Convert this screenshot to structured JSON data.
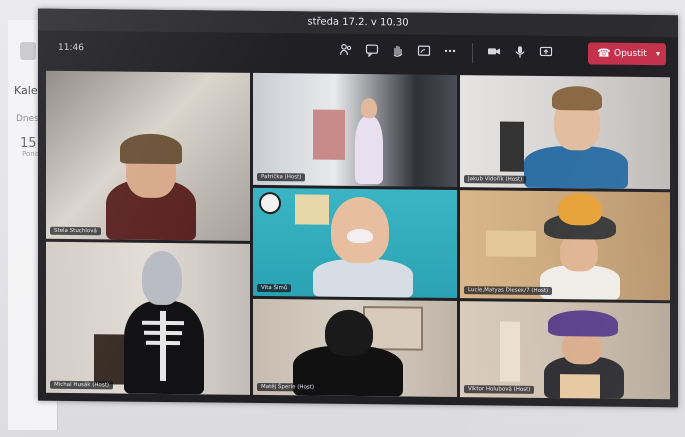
{
  "background_app": {
    "label": "Kalen",
    "small_text": "Dnes",
    "day_number": "15",
    "day_name": "Pondělí"
  },
  "meeting": {
    "title": "středa 17.2. v 10.30",
    "timer": "11:46",
    "leave_label": "Opustit",
    "toolbar_icons": [
      "people-icon",
      "chat-icon",
      "raise-hand-icon",
      "share-tray-icon",
      "more-icon",
      "camera-icon",
      "mic-icon",
      "share-screen-icon"
    ],
    "participants": [
      {
        "name": "Stela Stuchlová"
      },
      {
        "name": "Patrička (Host)"
      },
      {
        "name": "Jakub Vidořík (Host)"
      },
      {
        "name": "Vita Šimů"
      },
      {
        "name": "Lucie,Matyas Dlesek/7 (Host)"
      },
      {
        "name": "Michal Husák (Host)"
      },
      {
        "name": "Matěj Šperle (Host)"
      },
      {
        "name": "Viktor Holubová (Host)"
      }
    ]
  },
  "colors": {
    "leave": "#c4314b",
    "window": "#1f1f24",
    "toolbar": "#202024"
  }
}
